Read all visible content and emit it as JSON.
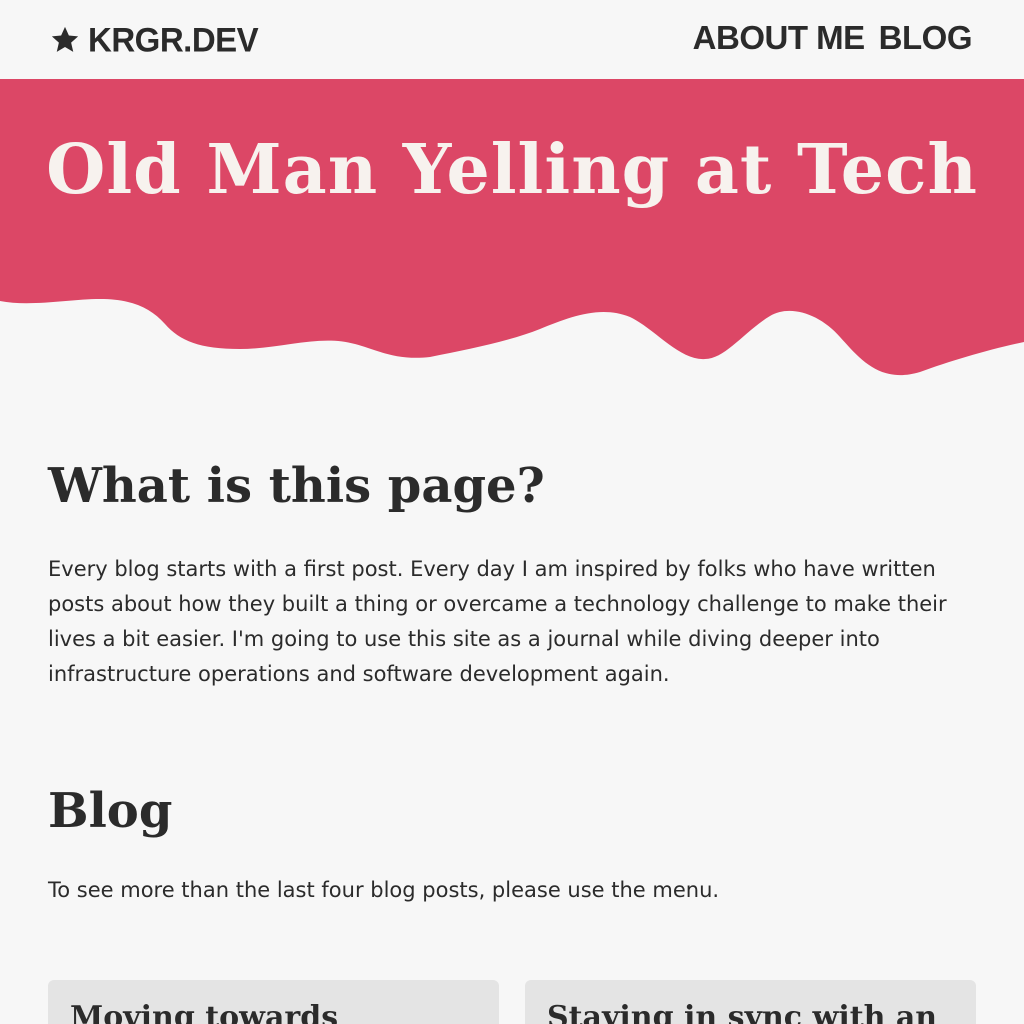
{
  "nav": {
    "brand": "KRGR.DEV",
    "brand_icon": "star-icon",
    "links": [
      "ABOUT ME",
      "BLOG"
    ]
  },
  "hero": {
    "title": "Old Man Yelling at Tech",
    "color": "#dc4766"
  },
  "about": {
    "heading": "What is this page?",
    "body": "Every blog starts with a first post. Every day I am inspired by folks who have written posts about how they built a thing or overcame a technology challenge to make their lives a bit easier. I'm going to use this site as a journal while diving deeper into infrastructure operations and software development again."
  },
  "blog": {
    "heading": "Blog",
    "intro": "To see more than the last four blog posts, please use the menu.",
    "posts": [
      {
        "title": "Moving towards"
      },
      {
        "title": "Staying in sync with an"
      }
    ]
  },
  "colors": {
    "background": "#f7f7f7",
    "text": "#2b2b2b",
    "accent": "#dc4766",
    "card": "#e4e4e4"
  }
}
